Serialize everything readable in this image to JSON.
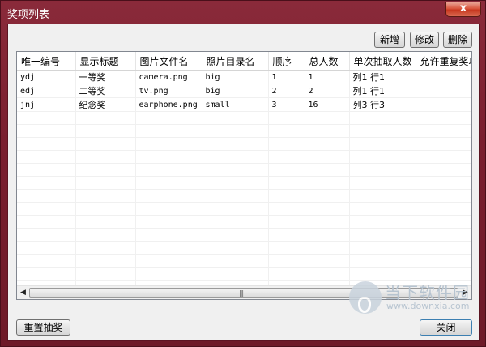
{
  "window": {
    "title": "奖项列表",
    "close_glyph": "x"
  },
  "toolbar": {
    "add_label": "新增",
    "edit_label": "修改",
    "delete_label": "删除"
  },
  "table": {
    "columns": [
      "唯一编号",
      "显示标题",
      "图片文件名",
      "照片目录名",
      "顺序",
      "总人数",
      "单次抽取人数",
      "允许重复奖项"
    ],
    "rows": [
      [
        "ydj",
        "一等奖",
        "camera.png",
        "big",
        "1",
        "1",
        "列1 行1",
        ""
      ],
      [
        "edj",
        "二等奖",
        "tv.png",
        "big",
        "2",
        "2",
        "列1 行1",
        ""
      ],
      [
        "jnj",
        "纪念奖",
        "earphone.png",
        "small",
        "3",
        "16",
        "列3 行3",
        ""
      ]
    ],
    "empty_rows": 15
  },
  "scrollbar": {
    "left_arrow": "◀",
    "right_arrow": "▶",
    "grip": "|||"
  },
  "footer": {
    "reset_label": "重置抽奖",
    "close_label": "关闭"
  },
  "watermark": {
    "name": "当下软件园",
    "url": "www.downxia.com"
  }
}
